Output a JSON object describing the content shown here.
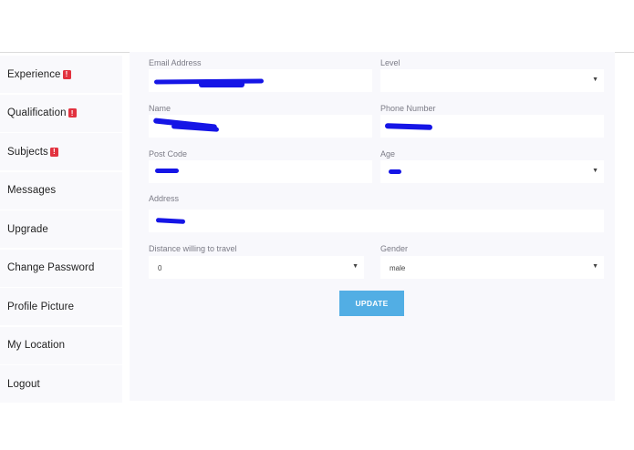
{
  "sidebar": {
    "items": [
      {
        "label": "Experience",
        "badge": "!"
      },
      {
        "label": "Qualification",
        "badge": "!"
      },
      {
        "label": "Subjects",
        "badge": "!"
      },
      {
        "label": "Messages"
      },
      {
        "label": "Upgrade"
      },
      {
        "label": "Change Password"
      },
      {
        "label": "Profile Picture"
      },
      {
        "label": "My Location"
      },
      {
        "label": "Logout"
      }
    ]
  },
  "form": {
    "email": {
      "label": "Email Address"
    },
    "level": {
      "label": "Level",
      "value": ""
    },
    "name": {
      "label": "Name"
    },
    "phone": {
      "label": "Phone Number"
    },
    "postcode": {
      "label": "Post Code"
    },
    "age": {
      "label": "Age"
    },
    "address": {
      "label": "Address"
    },
    "distance": {
      "label": "Distance willing to travel",
      "value": "0"
    },
    "gender": {
      "label": "Gender",
      "value": "male"
    },
    "update_label": "UPDATE"
  },
  "colors": {
    "badge": "#e2323f",
    "button": "#52aee4",
    "redaction": "#1515e6"
  }
}
